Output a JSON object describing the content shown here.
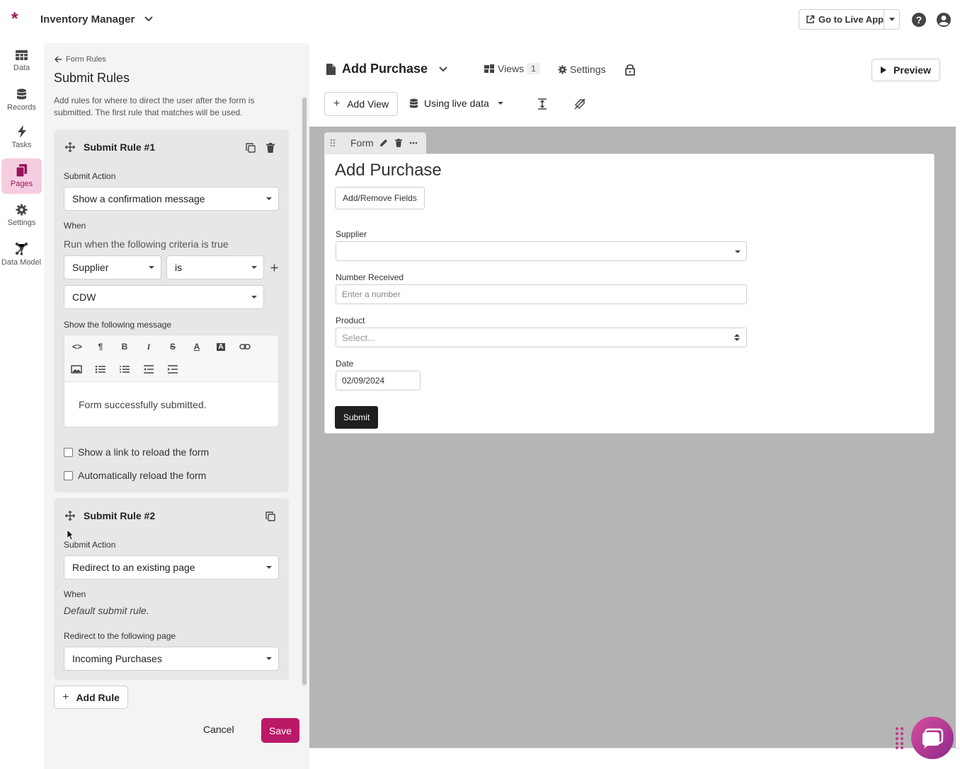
{
  "app": {
    "logo": "*",
    "title": "Inventory Manager",
    "go_live": "Go to Live App"
  },
  "nav": [
    {
      "label": "Data",
      "icon": "table-icon"
    },
    {
      "label": "Records",
      "icon": "database-icon"
    },
    {
      "label": "Tasks",
      "icon": "lightning-icon"
    },
    {
      "label": "Pages",
      "icon": "pages-icon",
      "active": true
    },
    {
      "label": "Settings",
      "icon": "gear-icon"
    },
    {
      "label": "Data Model",
      "icon": "data-model-icon"
    }
  ],
  "panel": {
    "breadcrumb": "Form Rules",
    "title": "Submit Rules",
    "description": "Add rules for where to direct the user after the form is submitted. The first rule that matches will be used.",
    "rule1": {
      "title": "Submit Rule #1",
      "action_label": "Submit Action",
      "action_value": "Show a confirmation message",
      "when_label": "When",
      "criteria_text": "Run when the following criteria is true",
      "field_value": "Supplier",
      "operator_value": "is",
      "match_value": "CDW",
      "message_label": "Show the following message",
      "message_text": "Form successfully submitted.",
      "check_reload_link": "Show a link to reload the form",
      "check_auto_reload": "Automatically reload the form"
    },
    "rule2": {
      "title": "Submit Rule #2",
      "action_label": "Submit Action",
      "action_value": "Redirect to an existing page",
      "when_label": "When",
      "default_text": "Default submit rule.",
      "redirect_label": "Redirect to the following page",
      "redirect_value": "Incoming Purchases"
    },
    "add_rule": "Add Rule",
    "cancel": "Cancel",
    "save": "Save"
  },
  "builder": {
    "page_name": "Add Purchase",
    "views_label": "Views",
    "views_count": "1",
    "settings_label": "Settings",
    "preview": "Preview",
    "add_view": "Add View",
    "live_data": "Using live data"
  },
  "form": {
    "tab_label": "Form",
    "title": "Add Purchase",
    "add_remove": "Add/Remove Fields",
    "supplier_label": "Supplier",
    "number_label": "Number Received",
    "number_placeholder": "Enter a number",
    "product_label": "Product",
    "product_placeholder": "Select...",
    "date_label": "Date",
    "date_value": "02/09/2024",
    "submit": "Submit"
  },
  "colors": {
    "brand": "#98145d",
    "save": "#bb1868",
    "active_nav": "#f6cde0",
    "canvas": "#b5b5b5"
  }
}
